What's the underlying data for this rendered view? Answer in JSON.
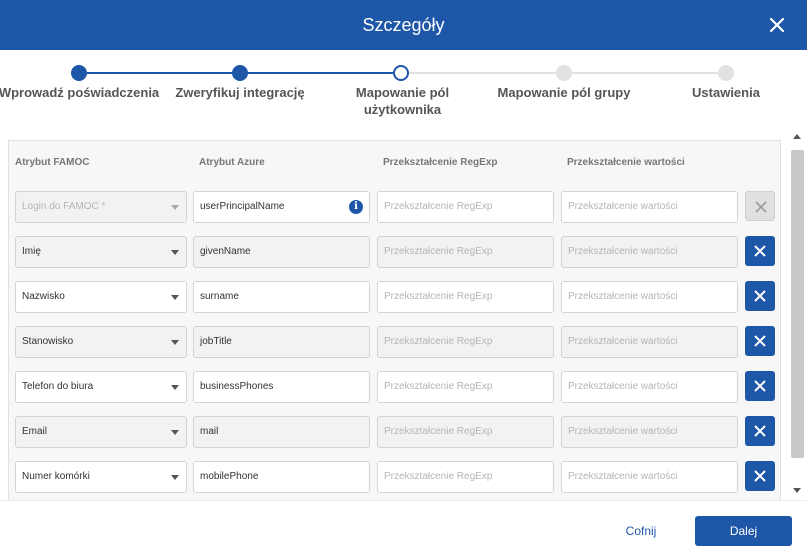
{
  "dialog": {
    "title": "Szczegóły"
  },
  "stepper": {
    "steps": [
      {
        "label": "Wprowadź poświadczenia",
        "state": "done"
      },
      {
        "label": "Zweryfikuj integrację",
        "state": "done"
      },
      {
        "label": "Mapowanie pól użytkownika",
        "state": "current"
      },
      {
        "label": "Mapowanie pól grupy",
        "state": "todo"
      },
      {
        "label": "Ustawienia",
        "state": "todo"
      }
    ]
  },
  "table": {
    "columns": [
      "Atrybut FAMOC",
      "Atrybut Azure",
      "Przekształcenie RegExp",
      "Przekształcenie wartości"
    ],
    "regexp_placeholder": "Przekształcenie RegExp",
    "value_placeholder": "Przekształcenie wartości",
    "rows": [
      {
        "famoc": "Login do FAMOC *",
        "azure": "userPrincipalName"
      },
      {
        "famoc": "Imię",
        "azure": "givenName"
      },
      {
        "famoc": "Nazwisko",
        "azure": "surname"
      },
      {
        "famoc": "Stanowisko",
        "azure": "jobTitle"
      },
      {
        "famoc": "Telefon do biura",
        "azure": "businessPhones"
      },
      {
        "famoc": "Email",
        "azure": "mail"
      },
      {
        "famoc": "Numer komórki",
        "azure": "mobilePhone"
      }
    ]
  },
  "footer": {
    "cancel_label": "Cofnij",
    "next_label": "Dalej"
  },
  "colors": {
    "primary": "#1e56a8",
    "step_todo": "#e2e2e2"
  }
}
